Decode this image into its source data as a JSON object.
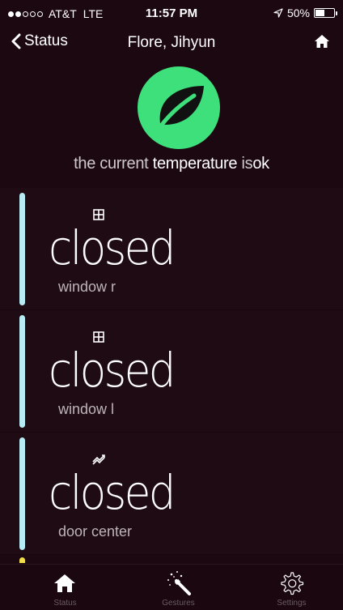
{
  "status_bar": {
    "carrier": "AT&T",
    "network": "LTE",
    "time": "11:57 PM",
    "battery": "50%",
    "battery_level": 0.5,
    "signal_bars_filled": 2,
    "signal_bars_total": 5
  },
  "nav": {
    "back_label": "Status",
    "title": "Flore, Jihyun",
    "home_icon": "home-icon"
  },
  "hero": {
    "icon": "leaf-icon",
    "accent_color": "#3ee07c",
    "temp_prefix": "the current",
    "temp_keyword": "temperature",
    "temp_is": "is",
    "temp_state": "ok"
  },
  "cards": [
    {
      "icon": "window-icon",
      "state": "closed",
      "name": "window r",
      "indicator_color": "#b8ecf5"
    },
    {
      "icon": "window-icon",
      "state": "closed",
      "name": "window l",
      "indicator_color": "#b8ecf5"
    },
    {
      "icon": "door-sensor-icon",
      "state": "closed",
      "name": "door center",
      "indicator_color": "#b8ecf5"
    }
  ],
  "tabs": [
    {
      "label": "Status",
      "icon": "home-icon"
    },
    {
      "label": "Gestures",
      "icon": "magic-wand-icon"
    },
    {
      "label": "Settings",
      "icon": "gear-icon"
    }
  ],
  "colors": {
    "background": "#1c0810",
    "card_background": "#1f0b14",
    "peek_indicator": "#f2dd4a"
  }
}
